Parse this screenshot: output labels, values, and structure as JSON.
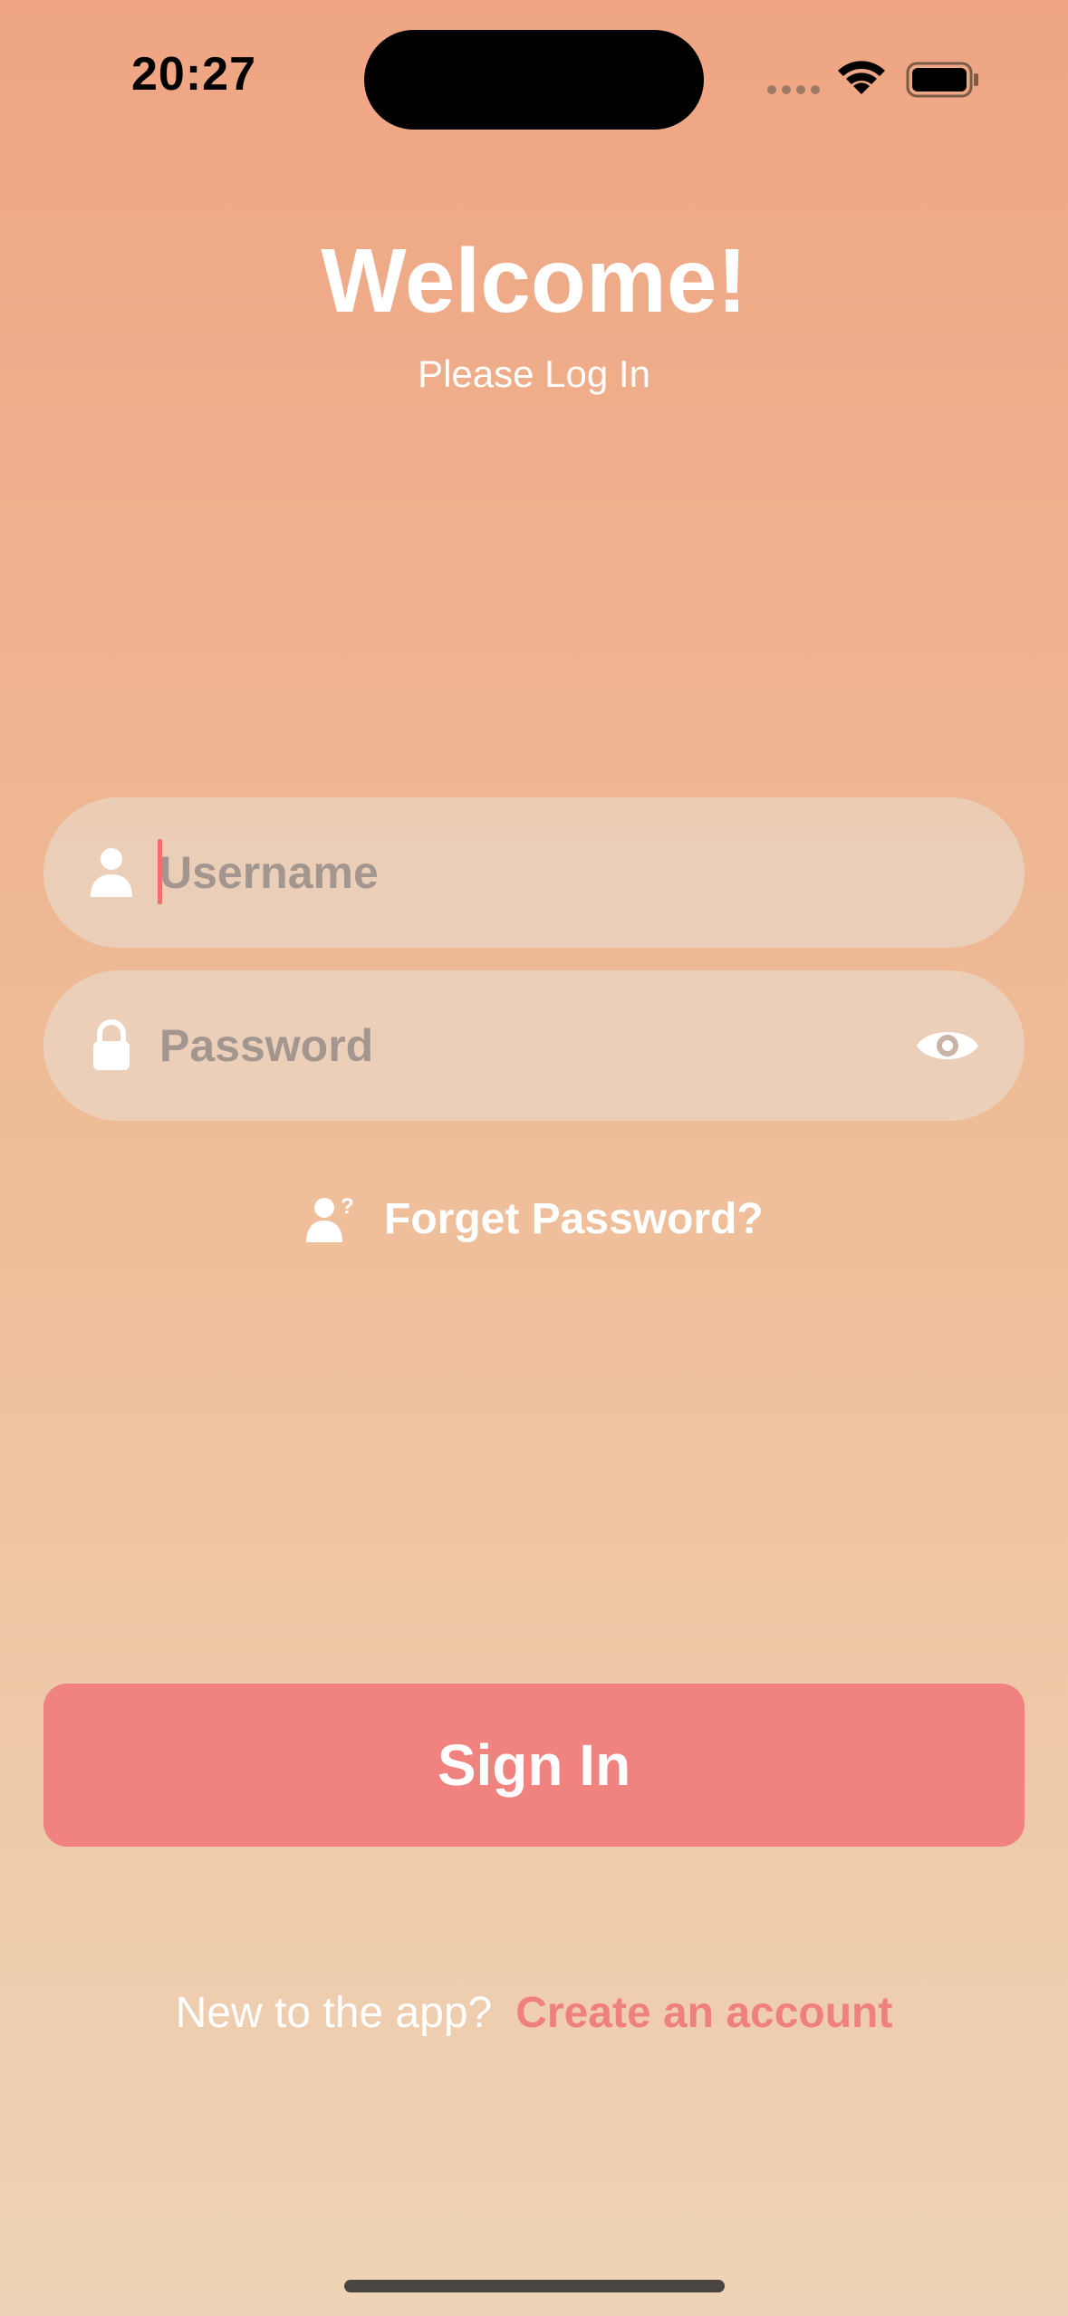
{
  "status_bar": {
    "time": "20:27",
    "icons": [
      "cellular-signal-icon",
      "wifi-icon",
      "battery-icon"
    ]
  },
  "header": {
    "title": "Welcome!",
    "subtitle": "Please Log In"
  },
  "form": {
    "username": {
      "placeholder": "Username",
      "value": "",
      "icon": "person-icon"
    },
    "password": {
      "placeholder": "Password",
      "value": "",
      "icon": "lock-icon",
      "toggle_icon": "eye-icon"
    }
  },
  "forget_password": {
    "label": "Forget Password?",
    "icon": "person-question-icon"
  },
  "sign_in": {
    "label": "Sign In"
  },
  "register": {
    "prompt": "New to the app?",
    "link": "Create an account"
  },
  "colors": {
    "accent": "#F0837F",
    "link": "#EF807D",
    "gradient_top": "#EFA583",
    "gradient_bottom": "#EED4B6"
  }
}
